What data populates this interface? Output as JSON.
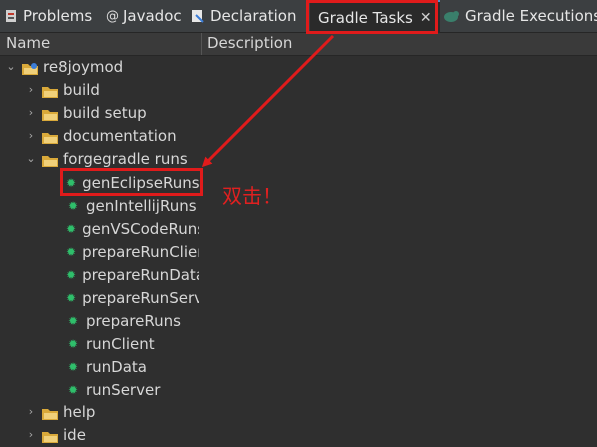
{
  "tabs": [
    {
      "label": "Problems",
      "icon": "problems-icon"
    },
    {
      "label": "Javadoc",
      "icon": "javadoc-icon"
    },
    {
      "label": "Declaration",
      "icon": "declaration-icon"
    },
    {
      "label": "Gradle Tasks",
      "icon": "gradle-tasks-icon",
      "active": true
    },
    {
      "label": "Gradle Executions",
      "icon": "gradle-executions-icon"
    }
  ],
  "columns": {
    "name": "Name",
    "description": "Description"
  },
  "tree": {
    "root": "re8joymod",
    "folders": [
      "build",
      "build setup",
      "documentation",
      "forgegradle runs",
      "help",
      "ide"
    ],
    "forgegradle_tasks": [
      "genEclipseRuns",
      "genIntellijRuns",
      "genVSCodeRuns",
      "prepareRunClient",
      "prepareRunData",
      "prepareRunServer",
      "prepareRuns",
      "runClient",
      "runData",
      "runServer"
    ]
  },
  "annotation": {
    "text": "双击！",
    "color": "#e01b1b"
  },
  "colors": {
    "accent": "#4a8fd1",
    "task_icon": "#2fbf6b",
    "highlight": "#e01b1b"
  }
}
